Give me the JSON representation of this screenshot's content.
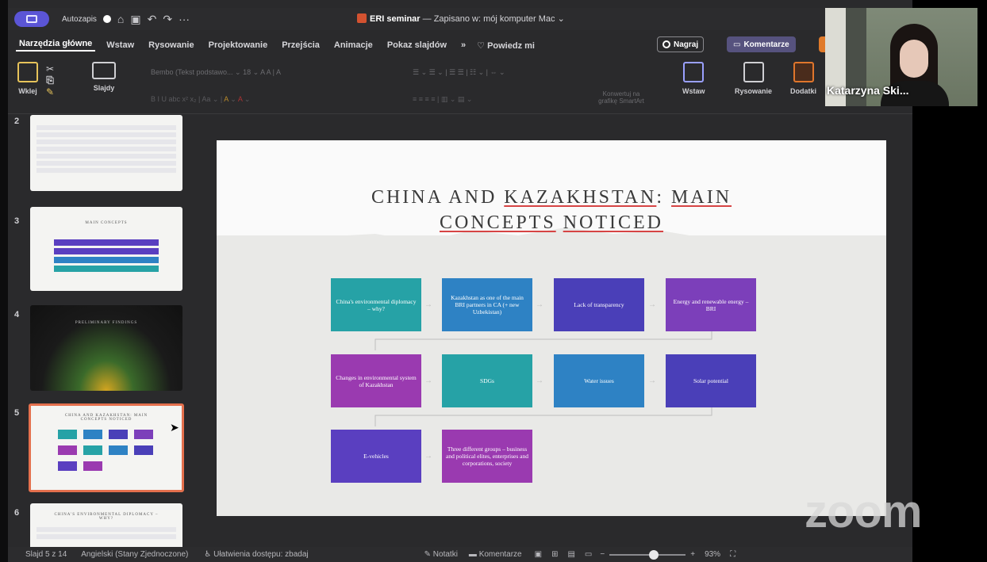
{
  "titlebar": {
    "autosave_label": "Autozapis",
    "title_name": "ERI seminar",
    "title_rest": " — Zapisano w: mój komputer Mac ⌄"
  },
  "menu": {
    "tabs": [
      "Narzędzia główne",
      "Wstaw",
      "Rysowanie",
      "Projektowanie",
      "Przejścia",
      "Animacje",
      "Pokaz slajdów",
      "»"
    ],
    "tell_me": "Powiedz mi",
    "record_label": "Nagraj",
    "comments_label": "Komentarze"
  },
  "ribbon": {
    "paste_label": "Wklej",
    "slides_label": "Slajdy",
    "font_name": "Bembo (Tekst podstawo... ⌄",
    "smartart_label": "Konwertuj na grafikę SmartArt",
    "insert_label": "Wstaw",
    "drawing_label": "Rysowanie",
    "addins_label": "Dodatki"
  },
  "thumbnails": {
    "numbers": [
      "2",
      "3",
      "4",
      "5",
      "6"
    ],
    "slide3_title": "MAIN CONCEPTS",
    "slide4_title": "PRELIMINARY FINDINGS",
    "slide5_title": "CHINA AND KAZAKHSTAN: MAIN CONCEPTS NOTICED",
    "slide6_title": "CHINA'S ENVIRONMENTAL DIPLOMACY – WHY?"
  },
  "slide": {
    "title_prefix": "CHINA AND ",
    "title_kazakhstan": "KAZAKHSTAN",
    "title_colon": ": ",
    "title_main": "MAIN",
    "title_line2a": "CONCEPTS",
    "title_space": " ",
    "title_line2b": "NOTICED",
    "boxes": [
      "China's environmental diplomacy – why?",
      "Kazakhstan as one of the main BRI partners in CA (+ new Uzbekistan)",
      "Lack of transparency",
      "Energy and renewable energy – BRI",
      "Changes in environmental system of Kazakhstan",
      "SDGs",
      "Water issues",
      "Solar potential",
      "E-vehicles",
      "Three different groups – business and political elites, enterprises and corporations, society"
    ],
    "colors": {
      "teal": "#26a2a6",
      "blue": "#2e82c4",
      "indigo": "#4a3fb8",
      "purple": "#7c3fba",
      "magenta": "#9a3ab0"
    }
  },
  "status": {
    "slide_counter": "Slajd 5 z 14",
    "language": "Angielski (Stany Zjednoczone)",
    "accessibility": "Ułatwienia dostępu: zbadaj",
    "notes": "Notatki",
    "comments": "Komentarze",
    "zoom_level": "93%"
  },
  "webcam": {
    "participant_name": "Katarzyna Ski..."
  },
  "watermark": "zoom"
}
